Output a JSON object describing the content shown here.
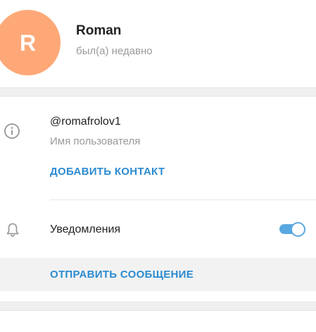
{
  "profile": {
    "avatar_letter": "R",
    "avatar_color": "#fea878",
    "name": "Roman",
    "status": "был(а) недавно"
  },
  "info": {
    "icon": "info-icon",
    "username": "@romafrolov1",
    "username_caption": "Имя пользователя",
    "add_contact_label": "ДОБАВИТЬ КОНТАКТ"
  },
  "notifications": {
    "icon": "bell-icon",
    "label": "Уведомления",
    "enabled": true
  },
  "actions": {
    "send_message_label": "ОТПРАВИТЬ СООБЩЕНИЕ"
  },
  "colors": {
    "accent": "#2b8bd0",
    "toggle_on": "#5aa8e0",
    "muted_text": "#9a9a9a"
  }
}
